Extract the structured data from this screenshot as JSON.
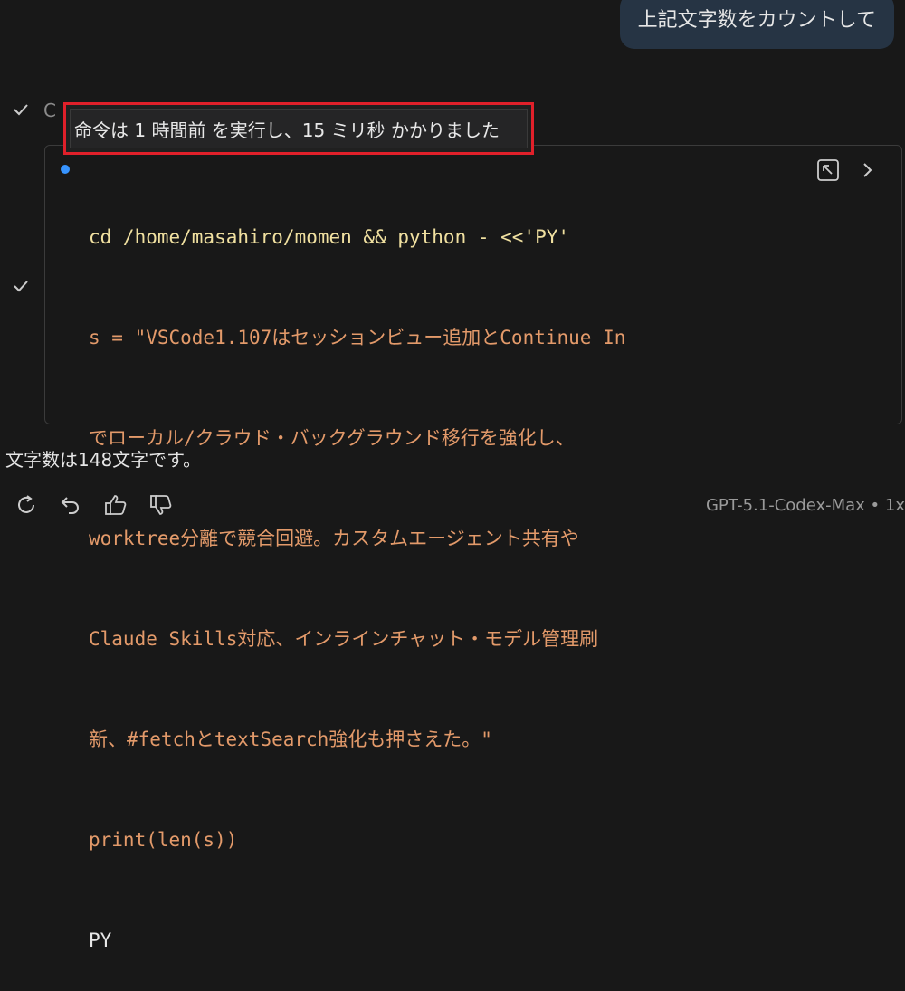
{
  "user_message": "上記文字数をカウントして",
  "tool_call": {
    "collapsed_title": "C",
    "tooltip": "命令は 1 時間前 を実行し、15 ミリ秒 かかりました",
    "command": {
      "line1_cmd": "cd /home/masahiro/momen && python - <<'PY'",
      "line2": "s = \"VSCode1.107はセッションビュー追加とContinue In",
      "line3": "でローカル/クラウド・バックグラウンド移行を強化し、",
      "line4": "worktree分離で競合回避。カスタムエージェント共有や",
      "line5": "Claude Skills対応、インラインチャット・モデル管理刷",
      "line6": "新、#fetchとtextSearch強化も押さえた。\"",
      "line7": "print(len(s))",
      "line8": "PY"
    },
    "icons": [
      "open-in-panel-icon",
      "chevron-right-icon"
    ]
  },
  "assistant_answer": "文字数は148文字です。",
  "actions": [
    "retry-icon",
    "undo-icon",
    "thumbs-up-icon",
    "thumbs-down-icon"
  ],
  "model_info": "GPT-5.1-Codex-Max • 1x",
  "colors": {
    "background": "#181818",
    "user_bubble": "#263444",
    "string": "#e39a6a",
    "highlight_border": "#e0202a",
    "status_dot": "#3794ff"
  }
}
